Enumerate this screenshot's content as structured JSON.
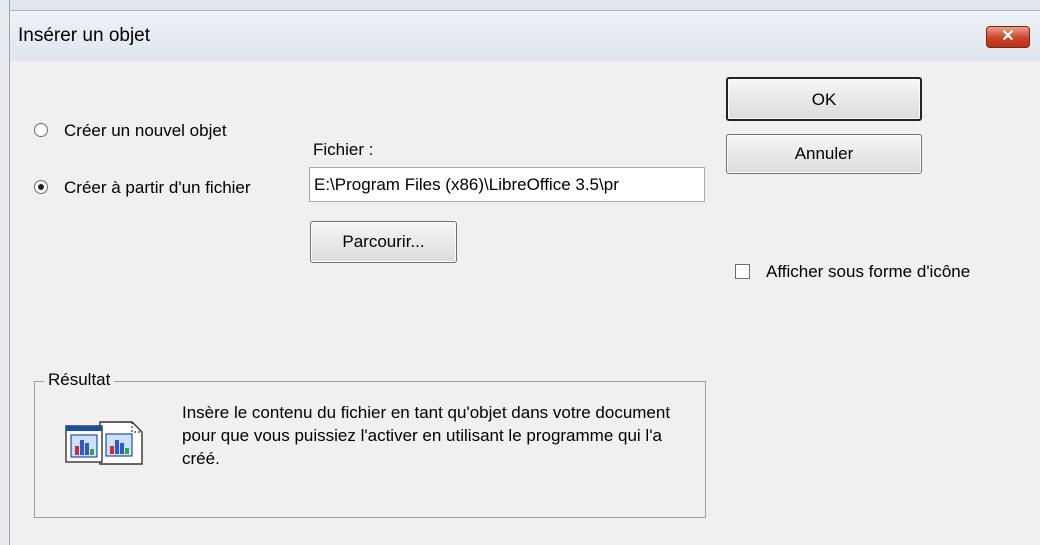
{
  "dialog": {
    "title": "Insérer un objet",
    "close_label": "✕"
  },
  "options": {
    "new_object_label": "Créer un nouvel objet",
    "from_file_label": "Créer à partir d'un fichier",
    "selected": "from_file"
  },
  "file": {
    "label": "Fichier :",
    "value": "E:\\Program Files (x86)\\LibreOffice 3.5\\pr",
    "browse_label": "Parcourir..."
  },
  "buttons": {
    "ok_label": "OK",
    "cancel_label": "Annuler"
  },
  "display_as_icon": {
    "label": "Afficher sous forme d'icône",
    "checked": false
  },
  "result": {
    "legend": "Résultat",
    "description": "Insère le contenu du fichier en tant qu'objet dans votre document pour que vous puissiez l'activer en utilisant le programme qui l'a créé."
  },
  "icons": {
    "close": "close-icon",
    "result": "embedded-object-icon"
  }
}
